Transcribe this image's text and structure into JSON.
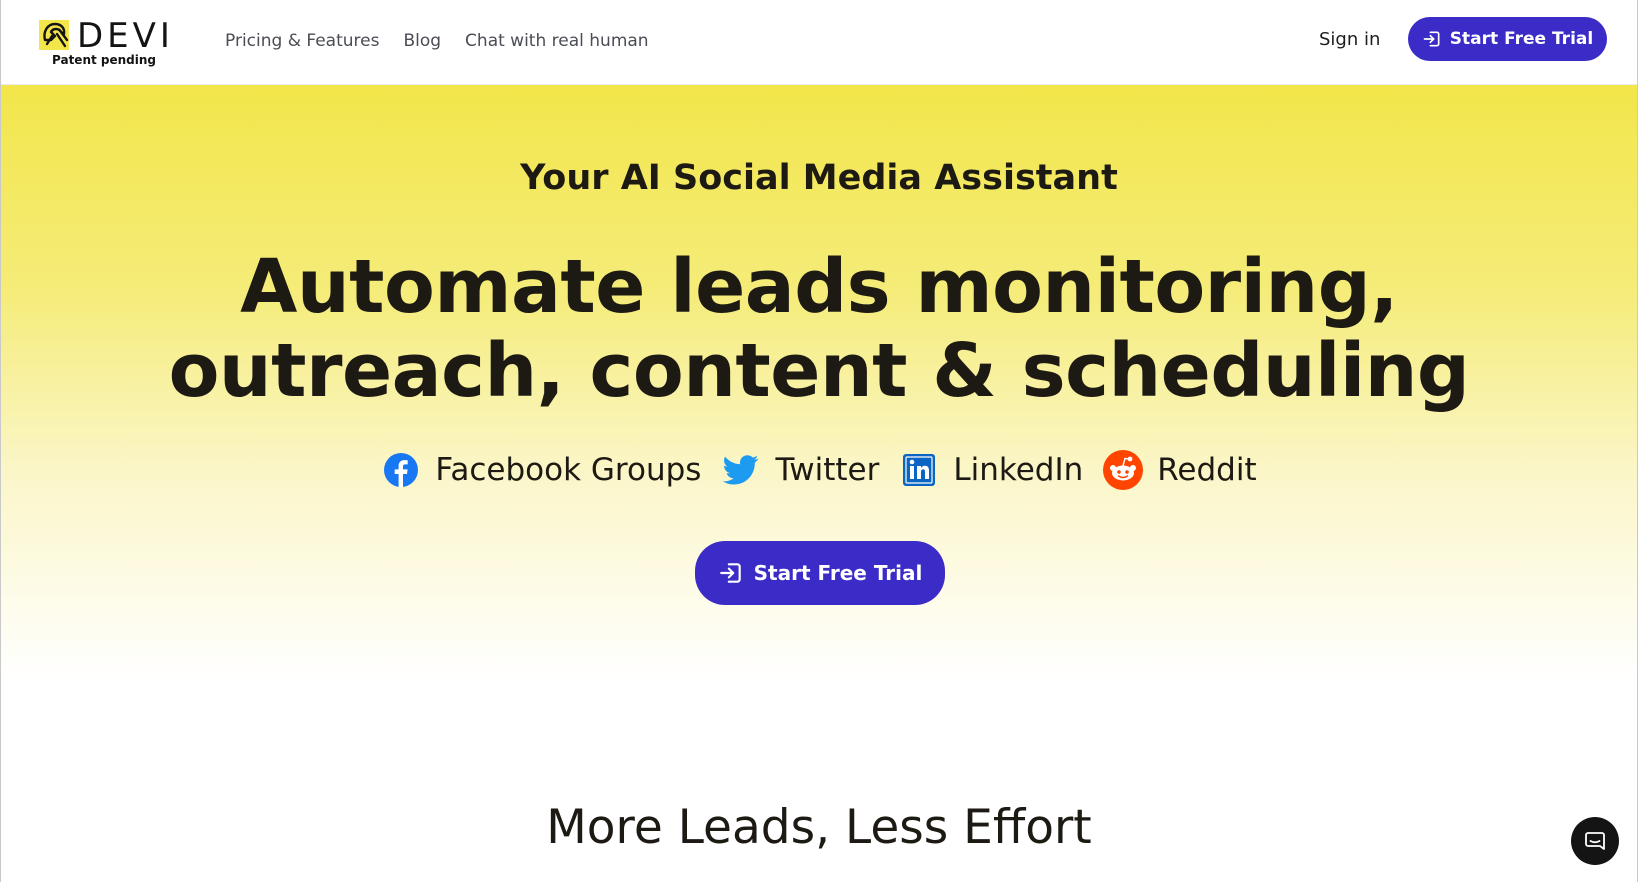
{
  "brand": {
    "name": "DEVI",
    "tagline": "Patent pending",
    "logo_icon": "hair-figure-icon",
    "logo_bg": "#f2e64a"
  },
  "nav": {
    "items": [
      {
        "label": "Pricing & Features"
      },
      {
        "label": "Blog"
      },
      {
        "label": "Chat with real human"
      }
    ],
    "signin_label": "Sign in",
    "cta_label": "Start Free Trial",
    "cta_icon": "login-arrow-icon"
  },
  "hero": {
    "eyebrow": "Your AI Social Media Assistant",
    "headline_line1": "Automate leads monitoring,",
    "headline_line2": "outreach, content & scheduling",
    "platforms": [
      {
        "label": "Facebook Groups",
        "icon": "facebook-icon",
        "color": "#1877f2"
      },
      {
        "label": "Twitter",
        "icon": "twitter-icon",
        "color": "#1d9bf0"
      },
      {
        "label": "LinkedIn",
        "icon": "linkedin-icon",
        "color": "#0a66c2"
      },
      {
        "label": "Reddit",
        "icon": "reddit-icon",
        "color": "#ff4500"
      }
    ],
    "cta_label": "Start Free Trial",
    "cta_icon": "login-arrow-icon"
  },
  "section": {
    "title": "More Leads, Less Effort"
  },
  "chat_widget": {
    "icon": "chat-bubble-icon"
  },
  "colors": {
    "accent": "#3b2cc7",
    "hero_yellow": "#f2e64a",
    "text": "#1d1a14"
  }
}
